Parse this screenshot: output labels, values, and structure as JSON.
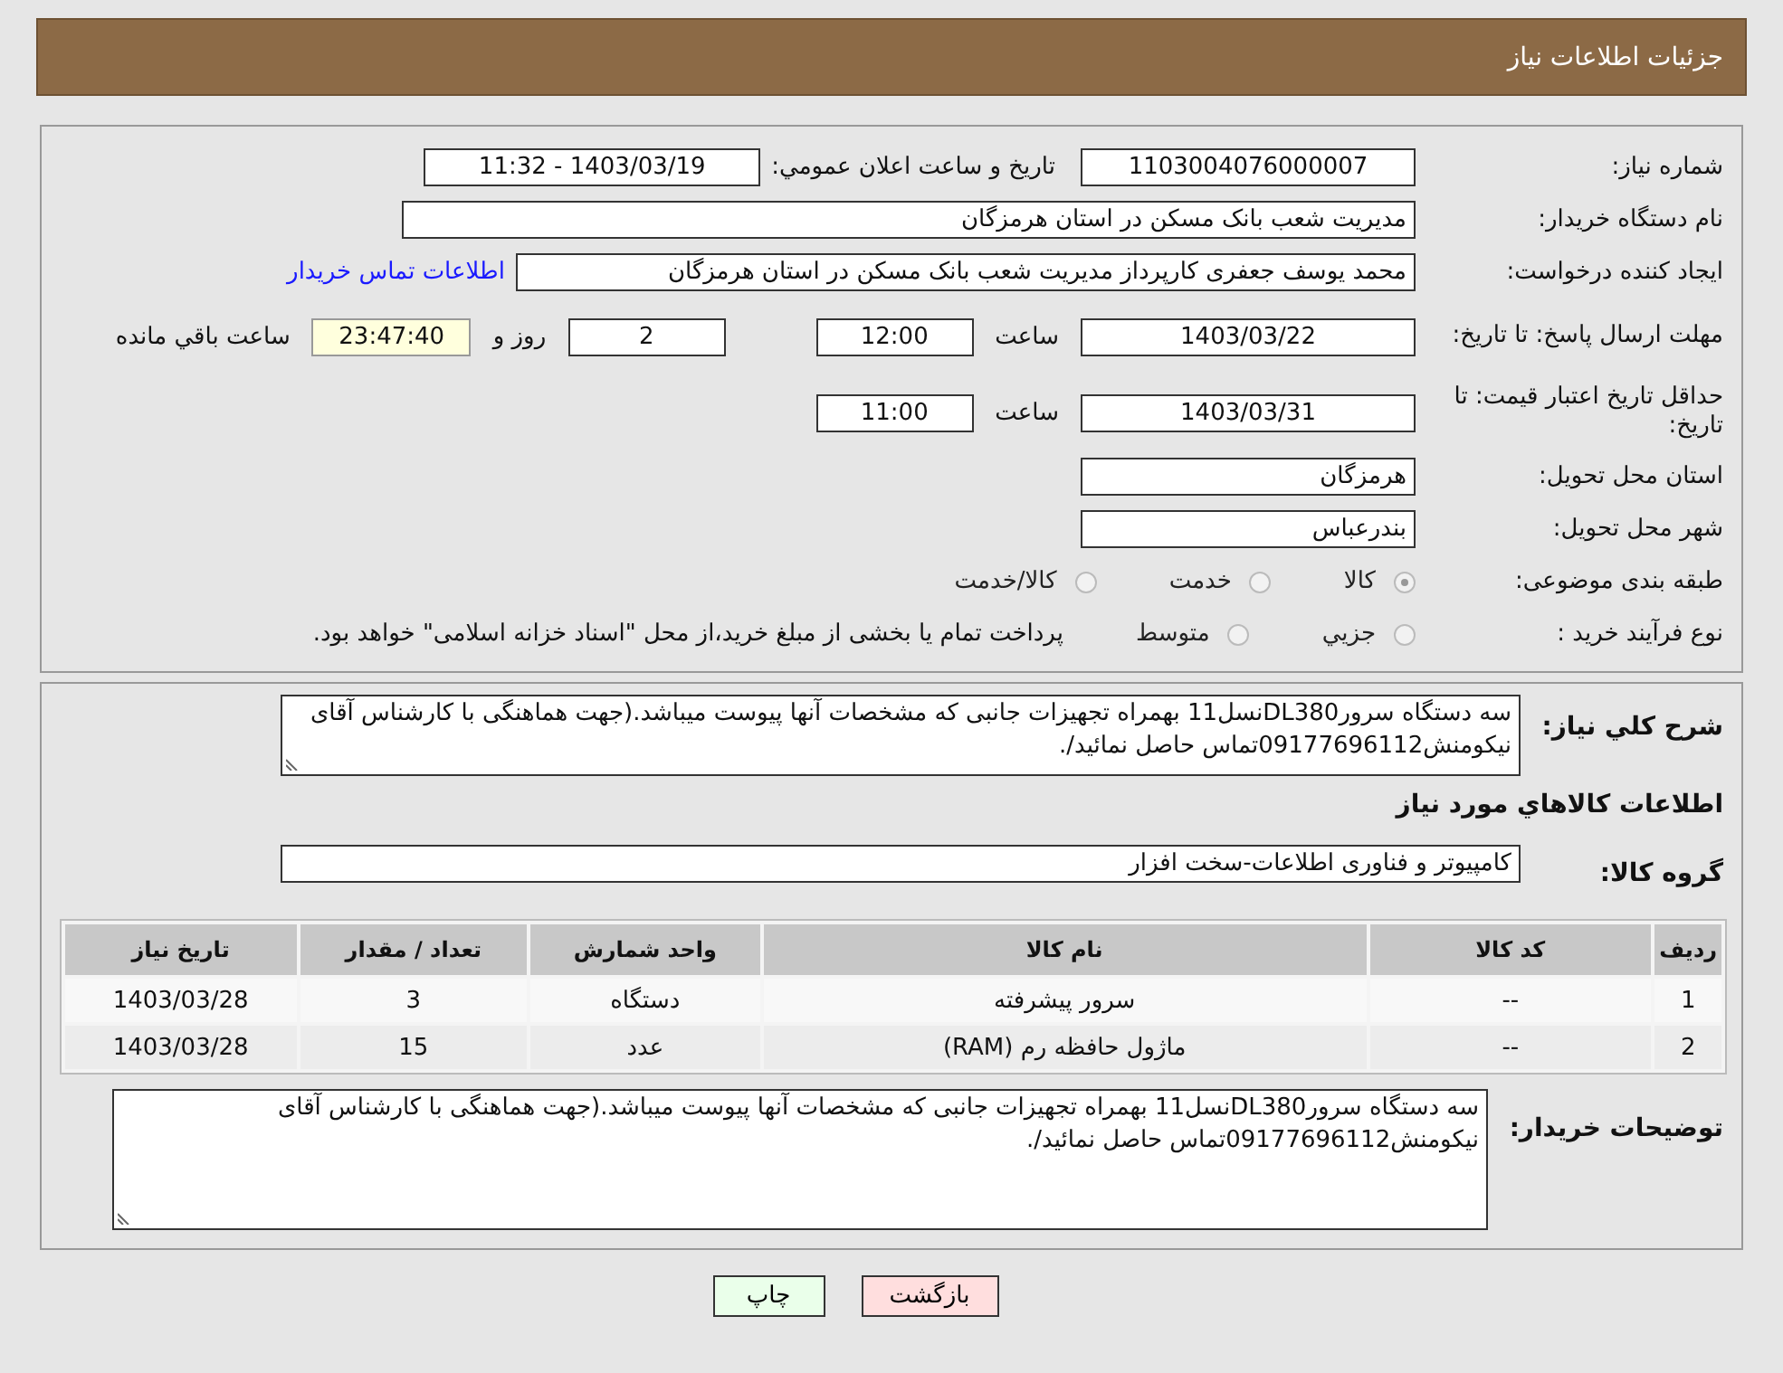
{
  "header": {
    "title": "جزئیات اطلاعات نیاز"
  },
  "need_number": {
    "label": "شماره نیاز:",
    "value": "1103004076000007"
  },
  "announce": {
    "label": "تاریخ و ساعت اعلان عمومي:",
    "value": "1403/03/19 - 11:32"
  },
  "buyer": {
    "label": "نام دستگاه خریدار:",
    "value": "مدیریت شعب بانک مسکن در استان هرمزگان"
  },
  "requester": {
    "label": "ایجاد کننده درخواست:",
    "value": "محمد  یوسف جعفری کارپرداز مدیریت شعب بانک مسکن در استان هرمزگان",
    "link": "اطلاعات تماس خریدار"
  },
  "deadline": {
    "label": "مهلت ارسال پاسخ: تا تاریخ:",
    "date": "1403/03/22",
    "time_label": "ساعت",
    "time": "12:00",
    "days": "2",
    "days_label": "روز و",
    "remaining": "23:47:40",
    "remaining_label": "ساعت باقي مانده"
  },
  "validity": {
    "label": "حداقل تاریخ اعتبار قیمت: تا تاریخ:",
    "date": "1403/03/31",
    "time_label": "ساعت",
    "time": "11:00"
  },
  "province": {
    "label": "استان محل تحویل:",
    "value": "هرمزگان"
  },
  "city": {
    "label": "شهر محل تحویل:",
    "value": "بندرعباس"
  },
  "category": {
    "label": "طبقه بندی موضوعی:",
    "options": [
      {
        "label": "کالا",
        "selected": true
      },
      {
        "label": "خدمت",
        "selected": false
      },
      {
        "label": "کالا/خدمت",
        "selected": false
      }
    ]
  },
  "purchase_type": {
    "label": "نوع فرآیند خرید :",
    "options": [
      {
        "label": "جزيي",
        "selected": false
      },
      {
        "label": "متوسط",
        "selected": false
      }
    ],
    "note": "پرداخت تمام یا بخشی از مبلغ خرید،از محل \"اسناد خزانه اسلامی\" خواهد بود."
  },
  "summary": {
    "label": "شرح کلي نیاز:",
    "value": "سه دستگاه سرورDL380نسل11 بهمراه تجهیزات جانبی که مشخصات آنها پیوست میباشد.(جهت هماهنگی با کارشناس آقای نیکومنش09177696112تماس حاصل نمائید/."
  },
  "goods_heading": "اطلاعات کالاهاي مورد نیاز",
  "goods_group": {
    "label": "گروه کالا:",
    "value": "کامپیوتر و فناوری اطلاعات-سخت افزار"
  },
  "table": {
    "columns": [
      "ردیف",
      "کد کالا",
      "نام کالا",
      "واحد شمارش",
      "تعداد / مقدار",
      "تاریخ نیاز"
    ],
    "rows": [
      [
        "1",
        "--",
        "سرور پیشرفته",
        "دستگاه",
        "3",
        "1403/03/28"
      ],
      [
        "2",
        "--",
        "ماژول حافظه رم (RAM)",
        "عدد",
        "15",
        "1403/03/28"
      ]
    ]
  },
  "buyer_notes": {
    "label": "توضیحات خریدار:",
    "value": "سه دستگاه سرورDL380نسل11 بهمراه تجهیزات جانبی که مشخصات آنها پیوست میباشد.(جهت هماهنگی با کارشناس آقای نیکومنش09177696112تماس حاصل نمائید/."
  },
  "buttons": [
    {
      "label": "بازگشت",
      "kind": "back"
    },
    {
      "label": "چاپ",
      "kind": "print"
    }
  ]
}
